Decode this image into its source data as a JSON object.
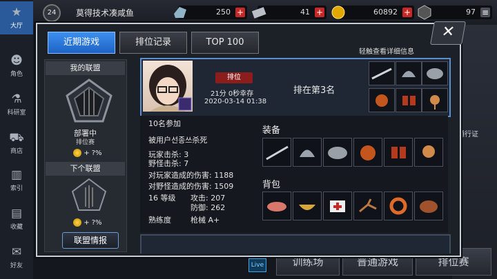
{
  "sidebar": {
    "items": [
      {
        "label": "大厅",
        "icon": "star-icon"
      },
      {
        "label": "角色",
        "icon": "character-icon"
      },
      {
        "label": "科研室",
        "icon": "flask-icon"
      },
      {
        "label": "商店",
        "icon": "cart-icon"
      },
      {
        "label": "索引",
        "icon": "books-icon"
      },
      {
        "label": "收藏",
        "icon": "book-icon"
      },
      {
        "label": "好友",
        "icon": "chat-icon"
      }
    ]
  },
  "player": {
    "level": "24",
    "name": "莫得技术凑咸鱼"
  },
  "resources": [
    {
      "icon": "crystal-icon",
      "value": "250"
    },
    {
      "icon": "card-icon",
      "value": "41"
    },
    {
      "icon": "gold-coin-icon",
      "value": "60892"
    },
    {
      "icon": "bp-icon",
      "value": "97"
    }
  ],
  "tabs": {
    "recent": "近期游戏",
    "rank_record": "排位记录",
    "top100": "TOP 100"
  },
  "hint": "轻触查看详细信息",
  "alliance": {
    "my_title": "我的联盟",
    "status": "部署中",
    "mode": "排位赛",
    "reward": "+ ?%",
    "next_title": "下个联盟",
    "next_reward": "+ ?%",
    "info_button": "联盟情报"
  },
  "match": {
    "tag": "排位",
    "survival": "21分 0秒幸存",
    "datetime": "2020-03-14 01:38",
    "placement": "排在第3名"
  },
  "detail": {
    "participants": "10名参加",
    "killed_by": "被用户선종쓰杀死",
    "player_kills": "玩家击杀: 3",
    "monster_kills": "野怪击杀: 7",
    "player_damage": "对玩家造成的伤害: 1188",
    "monster_damage": "对野怪造成的伤害: 1509",
    "level": "16 等级",
    "attack": "攻击: 207",
    "defense": "防御: 262",
    "mastery_label": "熟练度",
    "mastery_value": "枪械 A+",
    "equipment_label": "装备",
    "bag_label": "背包"
  },
  "background": {
    "btn_training": "训练场",
    "btn_normal": "普通游戏",
    "btn_ranked": "排位赛",
    "live": "Live",
    "text_fight": "通行证"
  },
  "colors": {
    "accent": "#2f7fe0",
    "rank_tag": "#8c1d1d",
    "card_border": "#5a8fd0"
  }
}
